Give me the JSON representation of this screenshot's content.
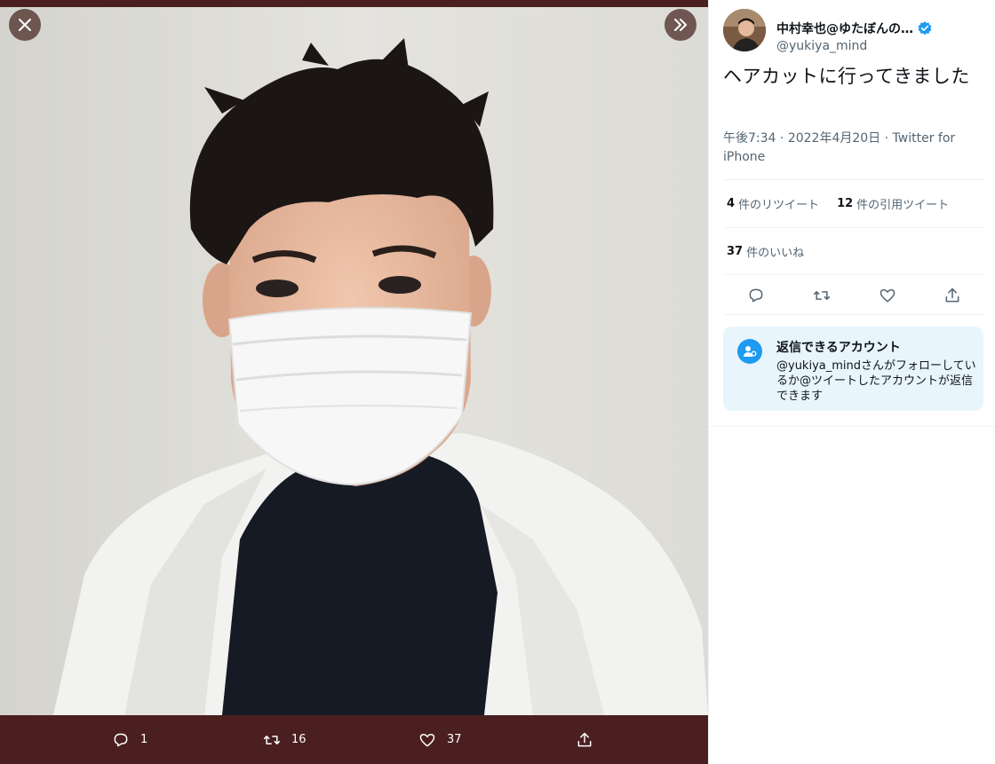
{
  "viewer": {
    "close_icon": "close-icon",
    "expand_icon": "double-chevron-right-icon",
    "bar": {
      "reply_count": "1",
      "retweet_count": "16",
      "like_count": "37"
    }
  },
  "tweet": {
    "display_name": "中村幸也@ゆたぼんの…",
    "handle": "@yukiya_mind",
    "verified": true,
    "text": "ヘアカットに行ってきました",
    "time": "午後7:34",
    "date": "2022年4月20日",
    "source": "Twitter for iPhone",
    "separator": " · ",
    "retweets": {
      "count": "4",
      "label": "件のリツイート"
    },
    "quotes": {
      "count": "12",
      "label": "件の引用ツイート"
    },
    "likes": {
      "count": "37",
      "label": "件のいいね"
    }
  },
  "reply_card": {
    "title": "返信できるアカウント",
    "description": "@yukiya_mindさんがフォローしているか@ツイートしたアカウントが返信できます"
  },
  "colors": {
    "accent": "#1d9bf0",
    "viewer_bar": "#4b1f1f",
    "muted_text": "#536471"
  }
}
